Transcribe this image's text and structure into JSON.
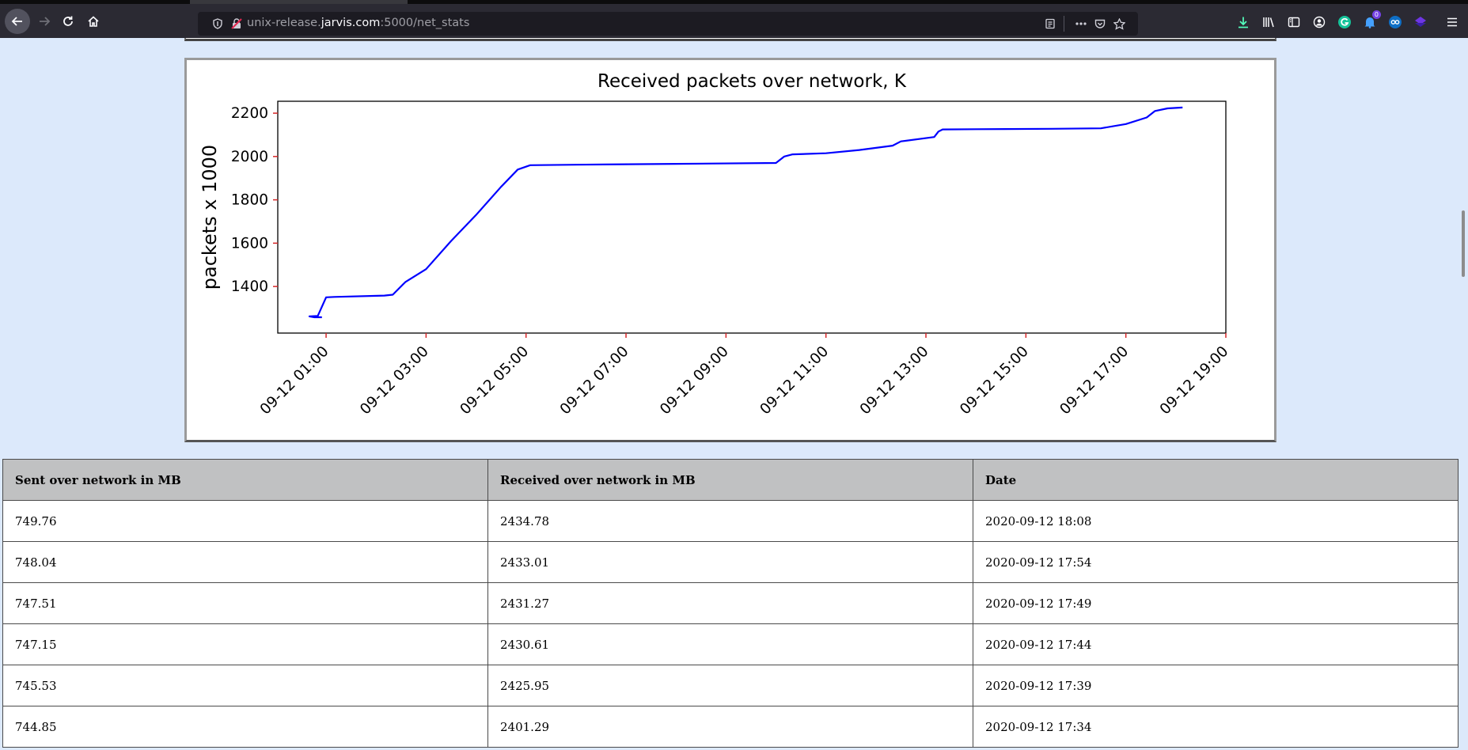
{
  "browser": {
    "url_prefix": "unix-release.",
    "url_host": "jarvis.com",
    "url_suffix": ":5000/net_stats",
    "notification_count": "0"
  },
  "chart_data": {
    "type": "line",
    "title": "Received packets over network, K",
    "xlabel": "",
    "ylabel": "packets x 1000",
    "line_color": "#0000ff",
    "ylim": [
      1185,
      2255
    ],
    "yticks": [
      1400,
      1600,
      1800,
      2000,
      2200
    ],
    "xlim": [
      "2020-09-12 00:02",
      "2020-09-12 19:00"
    ],
    "xticks": [
      {
        "t": "2020-09-12 01:00",
        "label": "09-12 01:00"
      },
      {
        "t": "2020-09-12 03:00",
        "label": "09-12 03:00"
      },
      {
        "t": "2020-09-12 05:00",
        "label": "09-12 05:00"
      },
      {
        "t": "2020-09-12 07:00",
        "label": "09-12 07:00"
      },
      {
        "t": "2020-09-12 09:00",
        "label": "09-12 09:00"
      },
      {
        "t": "2020-09-12 11:00",
        "label": "09-12 11:00"
      },
      {
        "t": "2020-09-12 13:00",
        "label": "09-12 13:00"
      },
      {
        "t": "2020-09-12 15:00",
        "label": "09-12 15:00"
      },
      {
        "t": "2020-09-12 17:00",
        "label": "09-12 17:00"
      },
      {
        "t": "2020-09-12 19:00",
        "label": "09-12 19:00"
      }
    ],
    "series": [
      {
        "x": [
          "2020-09-12 00:55",
          "2020-09-12 00:46",
          "2020-09-12 00:40",
          "2020-09-12 00:41",
          "2020-09-12 00:50",
          "2020-09-12 01:00",
          "2020-09-12 01:10",
          "2020-09-12 02:10",
          "2020-09-12 02:20",
          "2020-09-12 02:35",
          "2020-09-12 03:00",
          "2020-09-12 03:30",
          "2020-09-12 04:00",
          "2020-09-12 04:30",
          "2020-09-12 04:50",
          "2020-09-12 05:05",
          "2020-09-12 06:00",
          "2020-09-12 08:00",
          "2020-09-12 10:00",
          "2020-09-12 10:10",
          "2020-09-12 10:20",
          "2020-09-12 11:00",
          "2020-09-12 11:40",
          "2020-09-12 12:20",
          "2020-09-12 12:30",
          "2020-09-12 13:10",
          "2020-09-12 13:15",
          "2020-09-12 13:20",
          "2020-09-12 14:00",
          "2020-09-12 15:30",
          "2020-09-12 16:30",
          "2020-09-12 17:00",
          "2020-09-12 17:25",
          "2020-09-12 17:35",
          "2020-09-12 17:50",
          "2020-09-12 18:08"
        ],
        "values": [
          1258,
          1258,
          1262,
          1262,
          1264,
          1350,
          1352,
          1358,
          1362,
          1420,
          1480,
          1610,
          1730,
          1860,
          1940,
          1960,
          1962,
          1966,
          1970,
          2000,
          2010,
          2015,
          2030,
          2050,
          2070,
          2090,
          2115,
          2125,
          2126,
          2128,
          2130,
          2150,
          2180,
          2210,
          2222,
          2226
        ]
      }
    ]
  },
  "table": {
    "headers": [
      "Sent over network in MB",
      "Received over network in MB",
      "Date"
    ],
    "rows": [
      [
        "749.76",
        "2434.78",
        "2020-09-12 18:08"
      ],
      [
        "748.04",
        "2433.01",
        "2020-09-12 17:54"
      ],
      [
        "747.51",
        "2431.27",
        "2020-09-12 17:49"
      ],
      [
        "747.15",
        "2430.61",
        "2020-09-12 17:44"
      ],
      [
        "745.53",
        "2425.95",
        "2020-09-12 17:39"
      ],
      [
        "744.85",
        "2401.29",
        "2020-09-12 17:34"
      ]
    ]
  }
}
